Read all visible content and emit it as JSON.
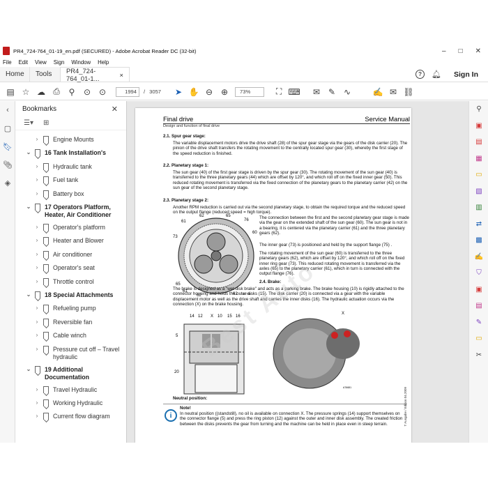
{
  "window": {
    "title": "PR4_724-764_01-19_en.pdf (SECURED) - Adobe Acrobat Reader DC (32-bit)",
    "controls": [
      "–",
      "□",
      "✕"
    ]
  },
  "menu": [
    "File",
    "Edit",
    "View",
    "Sign",
    "Window",
    "Help"
  ],
  "tabs": {
    "home": "Home",
    "tools": "Tools",
    "doc": "PR4_724-764_01-1...",
    "doc_close": "×",
    "sign_in": "Sign In"
  },
  "toolbar": {
    "page_current": "1994",
    "page_sep": "/",
    "page_total": "3057",
    "zoom": "73%"
  },
  "bookmarks": {
    "title": "Bookmarks",
    "items": [
      {
        "label": "Engine Mounts",
        "type": "child"
      },
      {
        "label": "16 Tank Installation's",
        "type": "parent"
      },
      {
        "label": "Hydraulic tank",
        "type": "child"
      },
      {
        "label": "Fuel tank",
        "type": "child"
      },
      {
        "label": "Battery box",
        "type": "child"
      },
      {
        "label": "17 Operators Platform, Heater, Air Conditioner",
        "type": "parent"
      },
      {
        "label": "Operator's platform",
        "type": "child"
      },
      {
        "label": "Heater and Blower",
        "type": "child"
      },
      {
        "label": "Air conditioner",
        "type": "child"
      },
      {
        "label": "Operator's seat",
        "type": "child"
      },
      {
        "label": "Throttle control",
        "type": "child"
      },
      {
        "label": "18 Special Attachments",
        "type": "parent"
      },
      {
        "label": "Refueling pump",
        "type": "child"
      },
      {
        "label": "Reversible fan",
        "type": "child"
      },
      {
        "label": "Cable winch",
        "type": "child"
      },
      {
        "label": "Pressure cut off – Travel hydraulic",
        "type": "child"
      },
      {
        "label": "19 Additional Documentation",
        "type": "parent"
      },
      {
        "label": "Travel Hydraulic",
        "type": "child"
      },
      {
        "label": "Working Hydraulic",
        "type": "child"
      },
      {
        "label": "Current flow diagram",
        "type": "child"
      }
    ]
  },
  "page": {
    "header_left": "Final drive",
    "header_right": "Service Manual",
    "subheader": "Design and function of final drive",
    "s1_title": "2.1. Spur gear stage:",
    "s1_text": "The variable displacement motors drive the drive shaft (28) of the spur gear stage via the gears of the disk carrier (20). The pinion of the drive shaft transfers the rotating movement to the centrally located spur gear (30), whereby the first stage of the speed reduction is finished.",
    "s2_title": "2.2. Planetary stage 1:",
    "s2_text": "The sun gear (40) of the first gear stage is driven by the spur gear (30). The rotating movement of the sun gear (40) is transferred to the three planetary gears (44) which are offset by 120°, and which roll off on the fixed inner gear (50). This reduced rotating movement is transferred via the fixed connection of the planetary gears to the planetary carrier (42) on the sun gear of the second planetary stage.",
    "s3_title": "2.3. Planetary stage 2:",
    "s3_text": "Another RPM reduction is carried out via the second planetary stage, to obtain the required torque and the reduced speed on the output flange (reduced speed = high torque).",
    "s3_p2": "The connection between the first and the second planetary gear stage is made via the gear on the extended shaft of the sun gear (60). The sun gear is not in a bearing, it is centered via the planetary carrier (61) and the three planetary gears (62).",
    "s3_p3": "The inner gear (73) is positioned and held by the support flange (75) .",
    "s3_p4": "The rotating movement of the sun gear (60) is transferred to the three planetary gears (62), which are offset by 120°, and which roll off on the fixed inner ring gear (73). This reduced rotating movement is transferred via the axles (65) to the planetary carrier (61), which in turn is connected with the output flange (76).",
    "s4_title": "2.4. Brake:",
    "s4_text": "The brake is designed as a \"wet disk brake\" and acts as a parking brake. The brake housing (10) is rigidly attached to the connector housing and holds the outer disks (15). The disk carrier (20) is connected via a gear with the variable displacement motor as well as the drive shaft and carries the inner disks (16). The hydraulic actuation occurs via the connection (X) on the brake housing.",
    "neutral_title": "Neutral position:",
    "note_title": "Note!",
    "note_text": "In neutral position ((standstill), no oil is available on connection X. The pressure springs (14) support themselves on the connector flange (5) and press the ring piston (12) against the outer and inner disk assembly. The created friction between the disks prevents the gear from turning and the machine can be held in place even in steep terrain.",
    "fig1_labels": [
      "61",
      "62",
      "65",
      "76",
      "60",
      "73",
      "65",
      "61",
      "62",
      "62"
    ],
    "fig1_code": "827786",
    "fig2_labels": [
      "14",
      "12",
      "X",
      "10",
      "15",
      "16",
      "5",
      "20"
    ],
    "fig3_code": "A76681",
    "side_code": "T Ausgabe / Edition 04.2009",
    "watermark": "Best Auto"
  }
}
